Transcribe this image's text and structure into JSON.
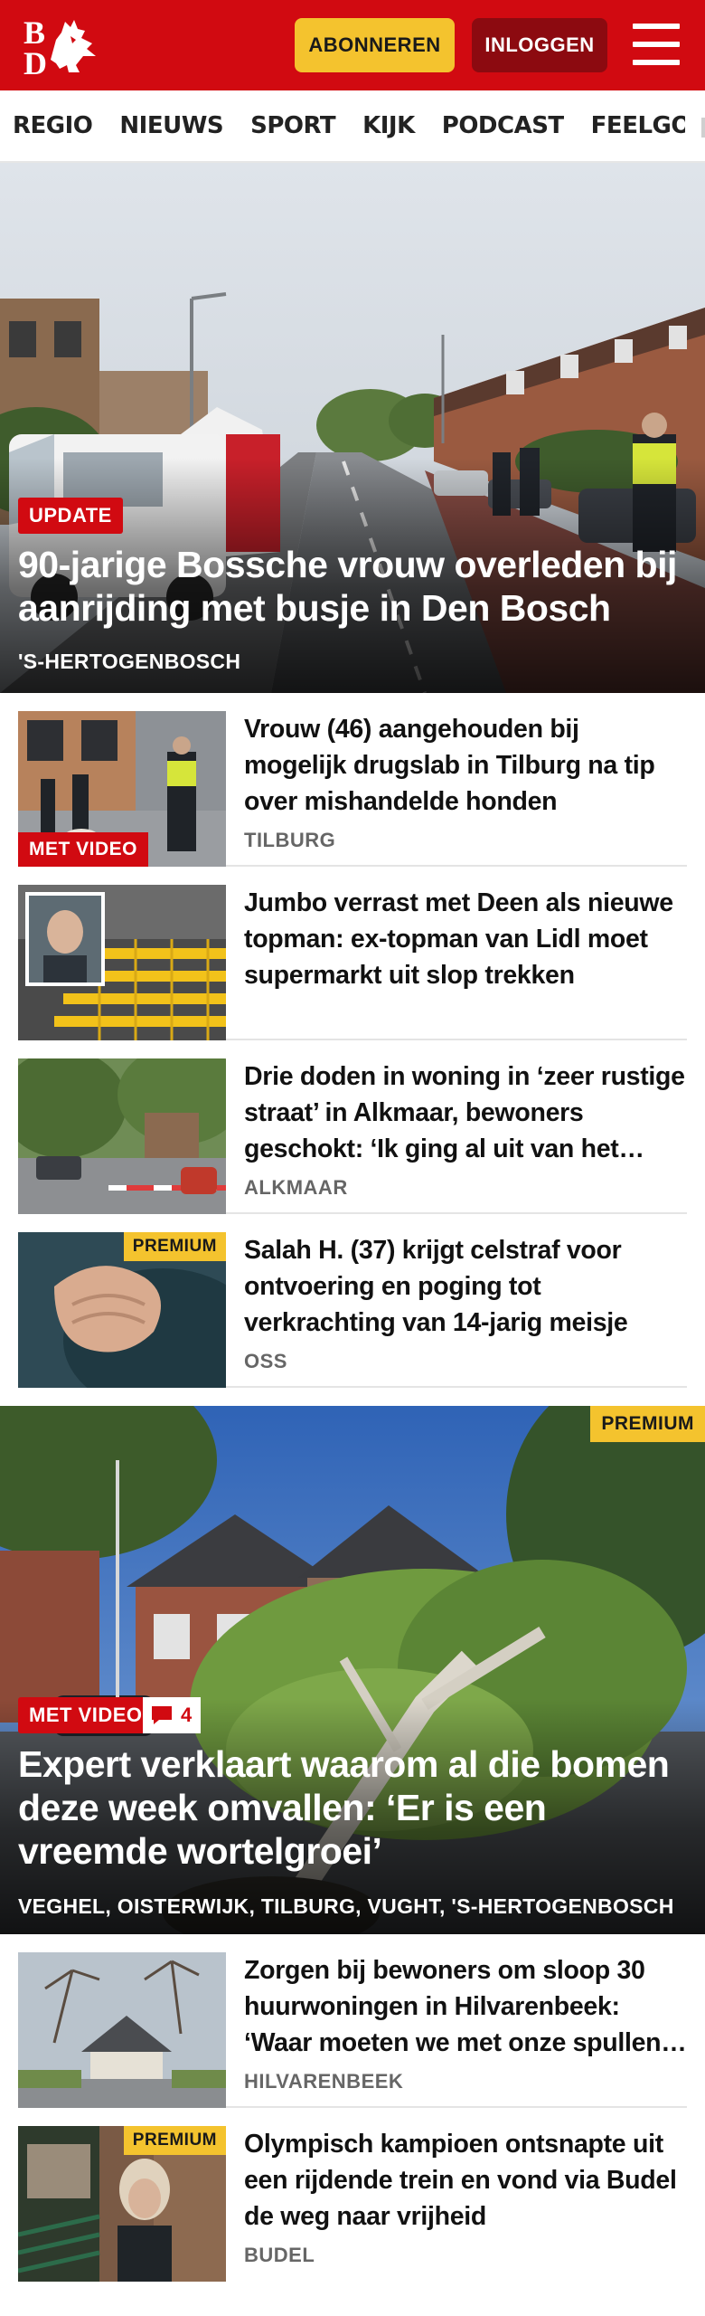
{
  "header": {
    "logo_text": "BD",
    "subscribe_label": "ABONNEREN",
    "login_label": "INLOGGEN",
    "brand_red": "#d10a11",
    "accent_yellow": "#f4c32e"
  },
  "nav": {
    "items": [
      "REGIO",
      "NIEUWS",
      "SPORT",
      "KIJK",
      "PODCAST",
      "FEELGOOD"
    ]
  },
  "hero1": {
    "label": "UPDATE",
    "title": "90-jarige Bossche vrouw overleden bij aanrijding met busje in Den Bosch",
    "location": "'S-HERTOGENBOSCH"
  },
  "list1": [
    {
      "title": "Vrouw (46) aangehouden bij mogelijk drugslab in Tilburg na tip over mishandelde honden",
      "location": "TILBURG",
      "label": "MET VIDEO",
      "premium": ""
    },
    {
      "title": "Jumbo verrast met Deen als nieuwe topman: ex-topman van Lidl moet supermarkt uit slop trekken",
      "location": "",
      "label": "",
      "premium": ""
    },
    {
      "title": "Drie doden in woning in ‘zeer rustige straat’ in Alkmaar, bewoners geschokt: ‘Ik ging al uit van het ergste’",
      "location": "ALKMAAR",
      "label": "",
      "premium": ""
    },
    {
      "title": "Salah H. (37) krijgt celstraf voor ontvoering en poging tot verkrachting van 14-jarig meisje",
      "location": "OSS",
      "label": "",
      "premium": "PREMIUM"
    }
  ],
  "hero2": {
    "premium": "PREMIUM",
    "label": "MET VIDEO",
    "comments": "4",
    "title": "Expert verklaart waarom al die bomen deze week omvallen: ‘Er is een vreemde wortelgroei’",
    "location": "VEGHEL, OISTERWIJK, TILBURG, VUGHT, 'S-HERTOGENBOSCH"
  },
  "list2": [
    {
      "title": "Zorgen bij bewoners om sloop 30 huurwoningen in Hilvarenbeek: ‘Waar moeten we met onze spullen heen?’",
      "location": "HILVARENBEEK",
      "premium": ""
    },
    {
      "title": "Olympisch kampioen ontsnapte uit een rijdende trein en vond via Budel de weg naar vrijheid",
      "location": "BUDEL",
      "premium": "PREMIUM"
    }
  ]
}
